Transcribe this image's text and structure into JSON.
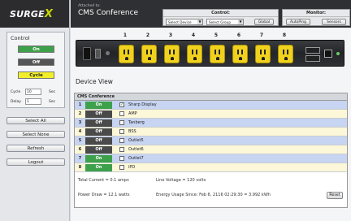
{
  "brand": {
    "name": "SURGE",
    "suffix": "X"
  },
  "left": {
    "control_title": "Control",
    "on_label": "On",
    "off_label": "Off",
    "cycle_label": "Cycle",
    "cycle_field_label": "Cycle",
    "cycle_value": "10",
    "cycle_unit": "Sec",
    "delay_field_label": "Delay",
    "delay_value": "1",
    "delay_unit": "Sec",
    "buttons": [
      "Select All",
      "Select None",
      "Refresh",
      "Logout"
    ]
  },
  "header": {
    "attached_label": "Attached to:",
    "conference_name": "CMS Conference",
    "control_title": "Control:",
    "monitor_title": "Monitor:",
    "select_device": "Select Device",
    "select_group": "Select Group",
    "global_button": "Global",
    "autoping_button": "AutoPing",
    "sensors_button": "Sensors"
  },
  "outlet_numbers": [
    "1",
    "2",
    "3",
    "4",
    "5",
    "6",
    "7",
    "8"
  ],
  "device_view_title": "Device View",
  "table": {
    "title": "CMS Conference",
    "rows": [
      {
        "num": "1",
        "state": "On",
        "checked": "✓",
        "name": "Sharp Display"
      },
      {
        "num": "2",
        "state": "Off",
        "checked": "",
        "name": "AMP"
      },
      {
        "num": "3",
        "state": "Off",
        "checked": "",
        "name": "Tanberg"
      },
      {
        "num": "4",
        "state": "Off",
        "checked": "",
        "name": "BSS"
      },
      {
        "num": "5",
        "state": "Off",
        "checked": "",
        "name": "Outlet5"
      },
      {
        "num": "6",
        "state": "Off",
        "checked": "",
        "name": "Outlet6"
      },
      {
        "num": "7",
        "state": "On",
        "checked": "",
        "name": "Outlet7"
      },
      {
        "num": "8",
        "state": "On",
        "checked": "",
        "name": "iPD"
      }
    ]
  },
  "summary": {
    "total_current": "Total Current = 0.1 amps",
    "line_voltage": "Line Voltage = 120 volts",
    "power_draw": "Power Draw = 12.1 watts",
    "energy_usage": "Energy Usage Since: Feb 6, 2116 02:29:30 = 3.992 kWh",
    "reset_label": "Reset"
  }
}
